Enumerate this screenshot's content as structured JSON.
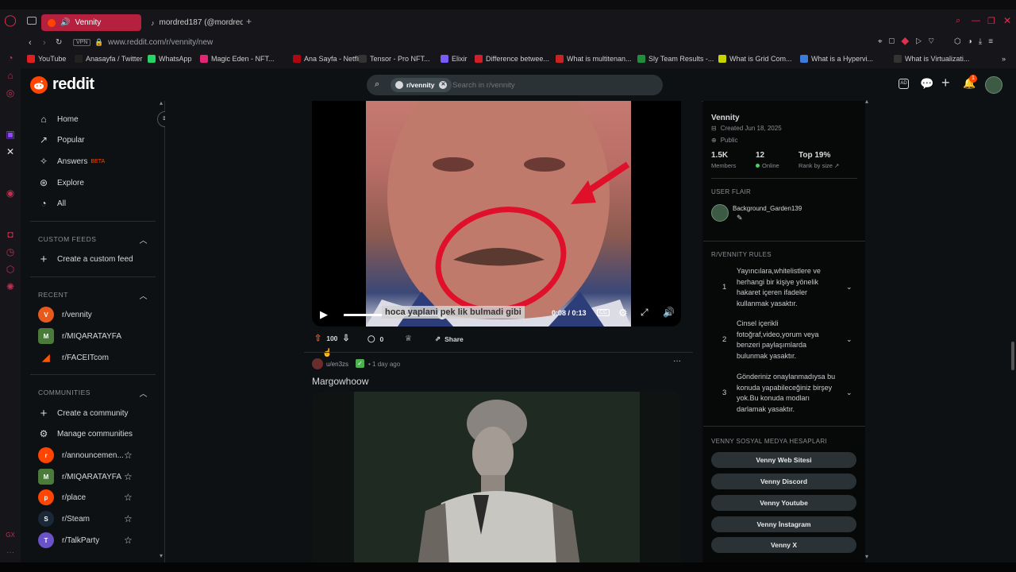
{
  "browser": {
    "tabs": [
      {
        "label": "Vennity",
        "active": true
      },
      {
        "label": "mordred187 (@mordred18",
        "active": false
      }
    ],
    "new_tab_icon": "plus-icon",
    "vpn_label": "VPN",
    "url": "www.reddit.com/r/vennity/new",
    "bookmarks": [
      {
        "label": "YouTube",
        "icon_color": "#e02020"
      },
      {
        "label": "Anasayfa / Twitter",
        "icon_color": "#222222"
      },
      {
        "label": "WhatsApp",
        "icon_color": "#25d366"
      },
      {
        "label": "Magic Eden - NFT...",
        "icon_color": "#e42575"
      },
      {
        "label": "Ana Sayfa - Netflix",
        "icon_color": "#b00610"
      },
      {
        "label": "Tensor - Pro NFT...",
        "icon_color": "#333333"
      },
      {
        "label": "Elixir",
        "icon_color": "#7a5af8"
      },
      {
        "label": "Difference betwee...",
        "icon_color": "#d0202a"
      },
      {
        "label": "What is multitenan...",
        "icon_color": "#cc2222"
      },
      {
        "label": "Sly Team Results -...",
        "icon_color": "#1e8e3e"
      },
      {
        "label": "What is Grid Com...",
        "icon_color": "#c8d400"
      },
      {
        "label": "What is a Hypervi...",
        "icon_color": "#3d7bd9"
      },
      {
        "label": "What is Virtualizati...",
        "icon_color": "#333333"
      }
    ]
  },
  "reddit": {
    "logo_text": "reddit",
    "brand_color": "#ff4500",
    "search": {
      "chip": "r/vennity",
      "placeholder": "Search in r/vennity"
    },
    "notif_count": "1"
  },
  "nav": {
    "items": [
      {
        "label": "Home",
        "icon": "home-icon"
      },
      {
        "label": "Popular",
        "icon": "popular-icon"
      },
      {
        "label": "Answers",
        "badge": "BETA",
        "icon": "answers-icon"
      },
      {
        "label": "Explore",
        "icon": "explore-icon"
      },
      {
        "label": "All",
        "icon": "all-icon"
      }
    ],
    "custom_feeds_title": "CUSTOM FEEDS",
    "create_custom_feed": "Create a custom feed",
    "recent_title": "RECENT",
    "recent": [
      {
        "label": "r/vennity",
        "color": "#e85a1c"
      },
      {
        "label": "r/MIQARATAYFA",
        "color": "#4a7b3a"
      },
      {
        "label": "r/FACEITcom",
        "color": "#ff5500"
      }
    ],
    "communities_title": "COMMUNITIES",
    "create_community": "Create a community",
    "manage_communities": "Manage communities",
    "communities": [
      {
        "label": "r/announcemen...",
        "color": "#ff4500"
      },
      {
        "label": "r/MIQARATAYFA",
        "color": "#4a7b3a"
      },
      {
        "label": "r/place",
        "color": "#ff4500"
      },
      {
        "label": "r/Steam",
        "color": "#1b2838"
      },
      {
        "label": "r/TalkParty",
        "color": "#6a52c8"
      }
    ]
  },
  "post1": {
    "video_caption": "hoca yaplani pek    lik bulmadi gibi",
    "time": "0:08 / 0:13",
    "progress": 0.62,
    "score": "100",
    "comments": "0",
    "share": "Share"
  },
  "post2": {
    "author": "u/en3zs",
    "age": "• 1 day ago",
    "title": "Margowhoow"
  },
  "sidebar": {
    "name": "Vennity",
    "created": "Created Jun 18, 2025",
    "visibility": "Public",
    "members_value": "1.5K",
    "members_label": "Members",
    "online_value": "12",
    "online_label": "Online",
    "rank_value": "Top 19%",
    "rank_label": "Rank by size",
    "flair_title": "USER FLAIR",
    "flair_user": "Background_Garden139",
    "rules_title": "R/VENNITY RULES",
    "rules": [
      {
        "n": "1",
        "text": "Yayıncılara,whitelistlere ve herhangi bir kişiye yönelik hakaret içeren ifadeler kullanmak yasaktır."
      },
      {
        "n": "2",
        "text": "Cinsel içerikli fotoğraf,video,yorum veya benzeri paylaşımlarda bulunmak yasaktır."
      },
      {
        "n": "3",
        "text": "Gönderiniz onaylanmadıysa bu konuda yapabileceğiniz birşey yok.Bu konuda modları darlamak yasaktır."
      }
    ],
    "social_title": "VENNY SOSYAL MEDYA HESAPLARI",
    "social": [
      "Venny Web Sitesi",
      "Venny Discord",
      "Venny Youtube",
      "Venny İnstagram",
      "Venny X"
    ]
  }
}
